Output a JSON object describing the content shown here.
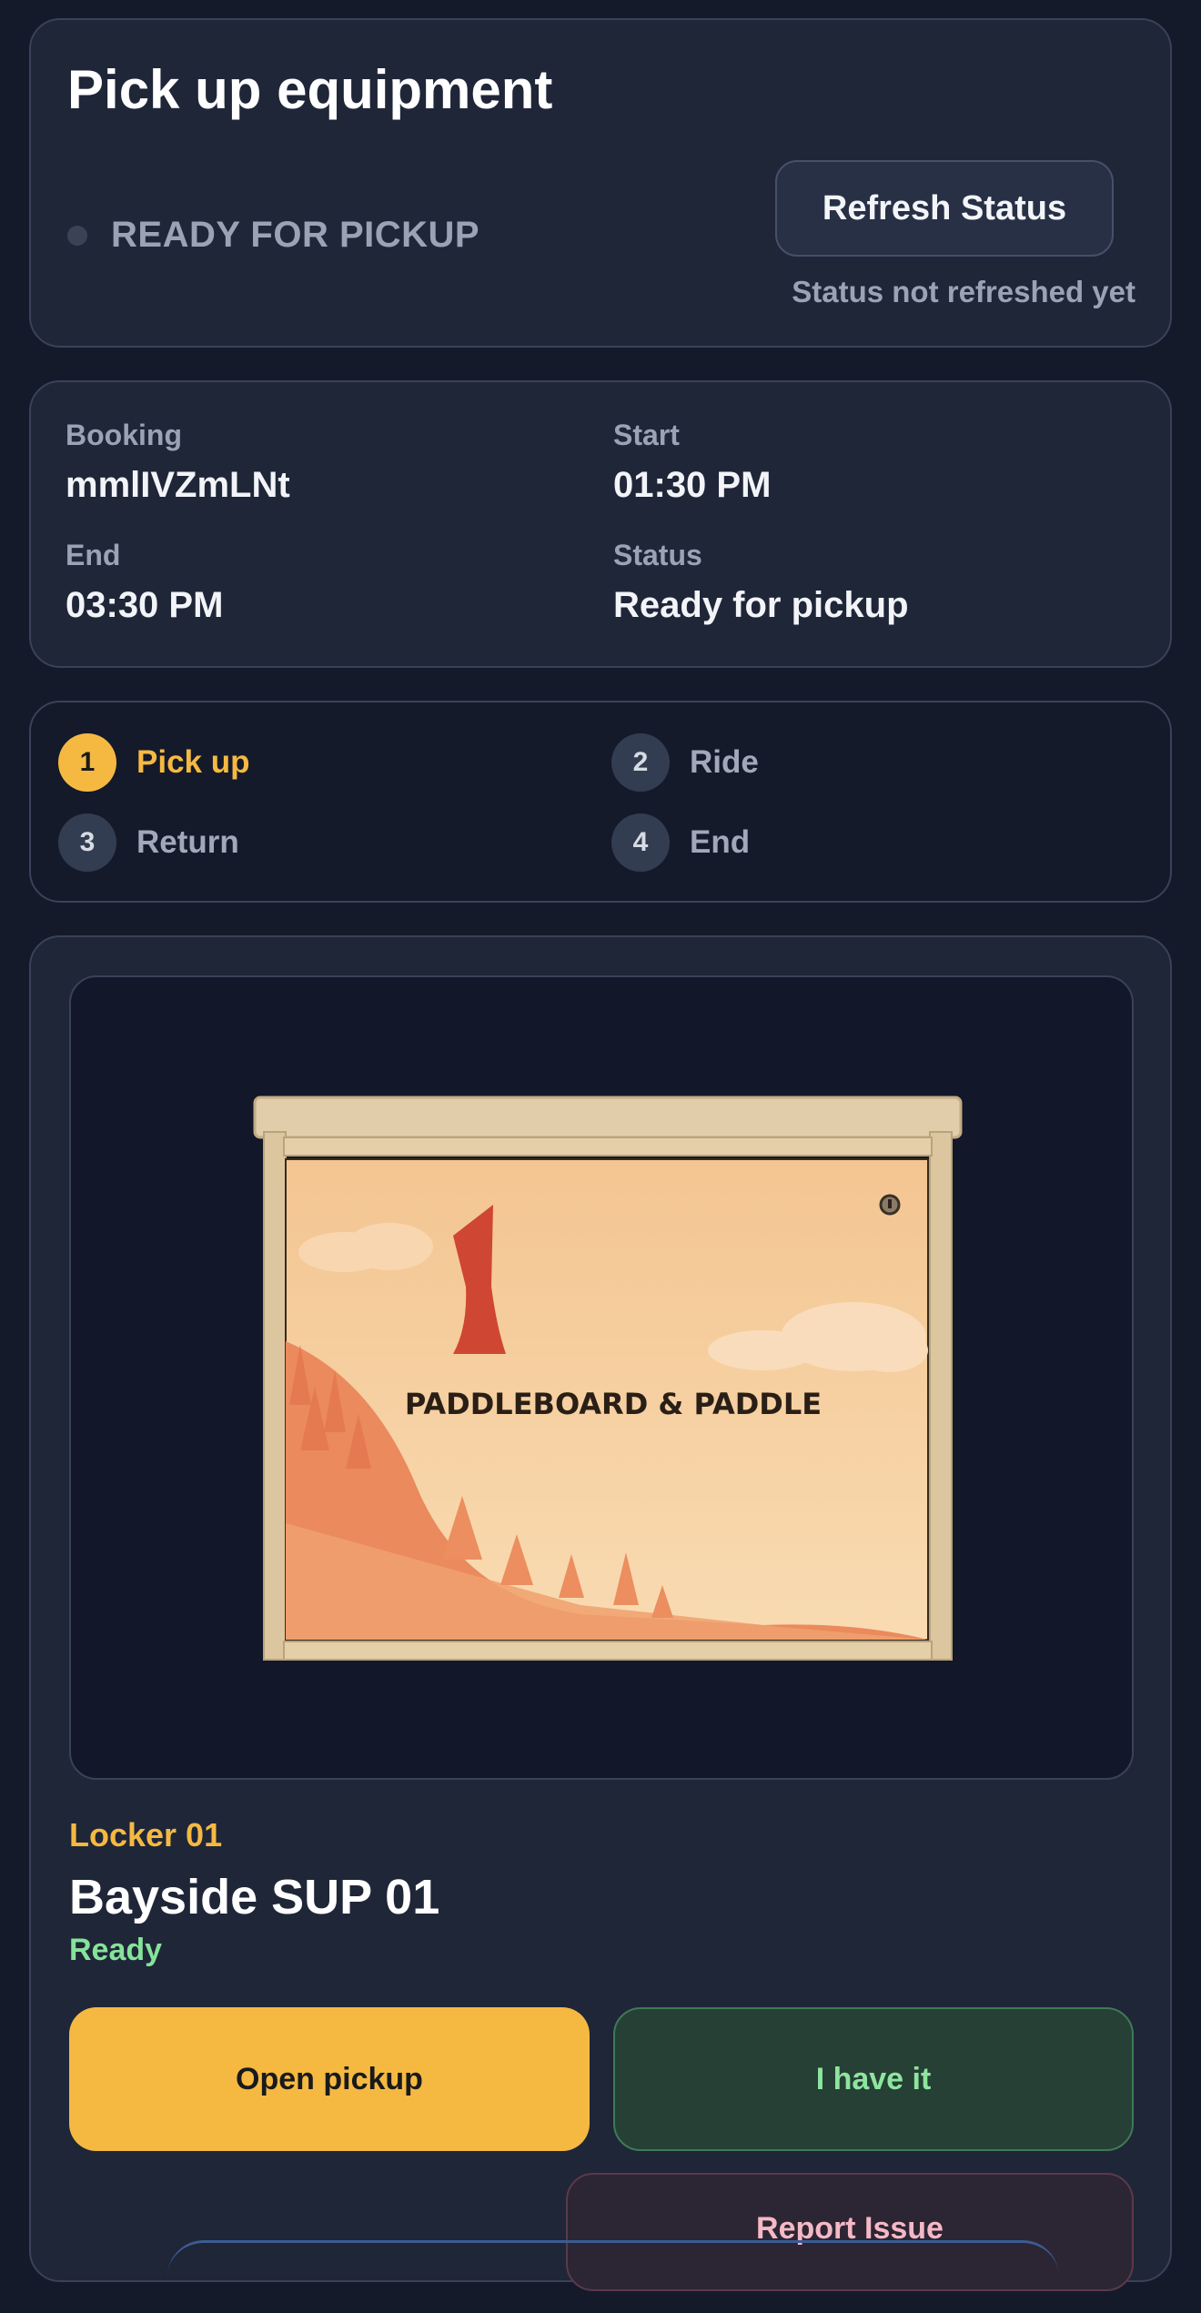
{
  "header": {
    "title": "Pick up equipment",
    "status": "READY FOR PICKUP",
    "refresh_button": "Refresh Status",
    "refresh_note": "Status not refreshed yet"
  },
  "booking": {
    "booking_label": "Booking",
    "booking_value": "mmlIVZmLNt",
    "start_label": "Start",
    "start_value": "01:30 PM",
    "end_label": "End",
    "end_value": "03:30 PM",
    "status_label": "Status",
    "status_value": "Ready for pickup"
  },
  "steps": [
    {
      "num": "1",
      "label": "Pick up",
      "active": true
    },
    {
      "num": "2",
      "label": "Ride",
      "active": false
    },
    {
      "num": "3",
      "label": "Return",
      "active": false
    },
    {
      "num": "4",
      "label": "End",
      "active": false
    }
  ],
  "locker": {
    "image_caption": "PADDLEBOARD & PADDLE",
    "number": "Locker 01",
    "name": "Bayside SUP 01",
    "status": "Ready",
    "open_button": "Open pickup",
    "have_button": "I have it",
    "report_button": "Report Issue"
  },
  "colors": {
    "background": "#141a2a",
    "card": "#1f2638",
    "accent": "#f5b942",
    "success": "#86e39a",
    "muted": "#9aa3b5"
  }
}
